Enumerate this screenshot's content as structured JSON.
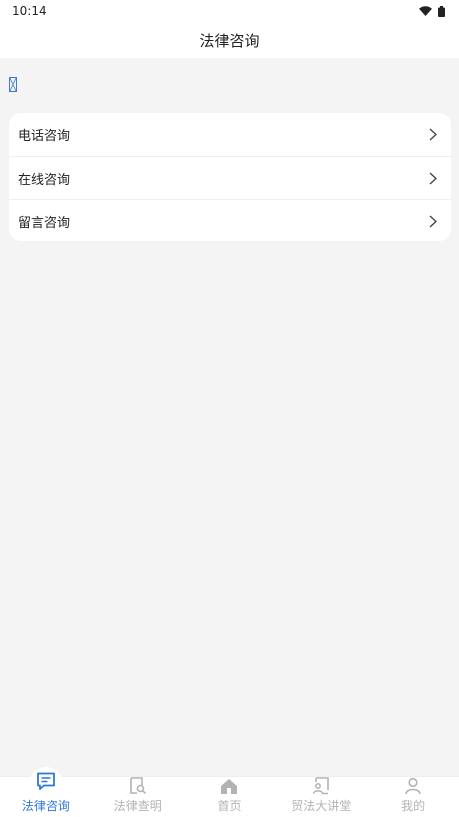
{
  "status_bar": {
    "time": "10:14",
    "icons": [
      "wifi-icon",
      "battery-icon"
    ]
  },
  "header": {
    "title": "法律咨询"
  },
  "menu": {
    "items": [
      {
        "label": "电话咨询",
        "icon": "chevron-right-icon"
      },
      {
        "label": "在线咨询",
        "icon": "chevron-right-icon"
      },
      {
        "label": "留言咨询",
        "icon": "chevron-right-icon"
      }
    ]
  },
  "tabbar": {
    "items": [
      {
        "label": "法律咨询",
        "icon": "chat-icon",
        "active": true
      },
      {
        "label": "法律查明",
        "icon": "document-search-icon",
        "active": false
      },
      {
        "label": "首页",
        "icon": "home-icon",
        "active": false
      },
      {
        "label": "贸法大讲堂",
        "icon": "lecture-icon",
        "active": false
      },
      {
        "label": "我的",
        "icon": "user-icon",
        "active": false
      }
    ]
  },
  "colors": {
    "accent": "#2f77d6",
    "inactive": "#b3b3b3",
    "background": "#f4f4f5"
  }
}
